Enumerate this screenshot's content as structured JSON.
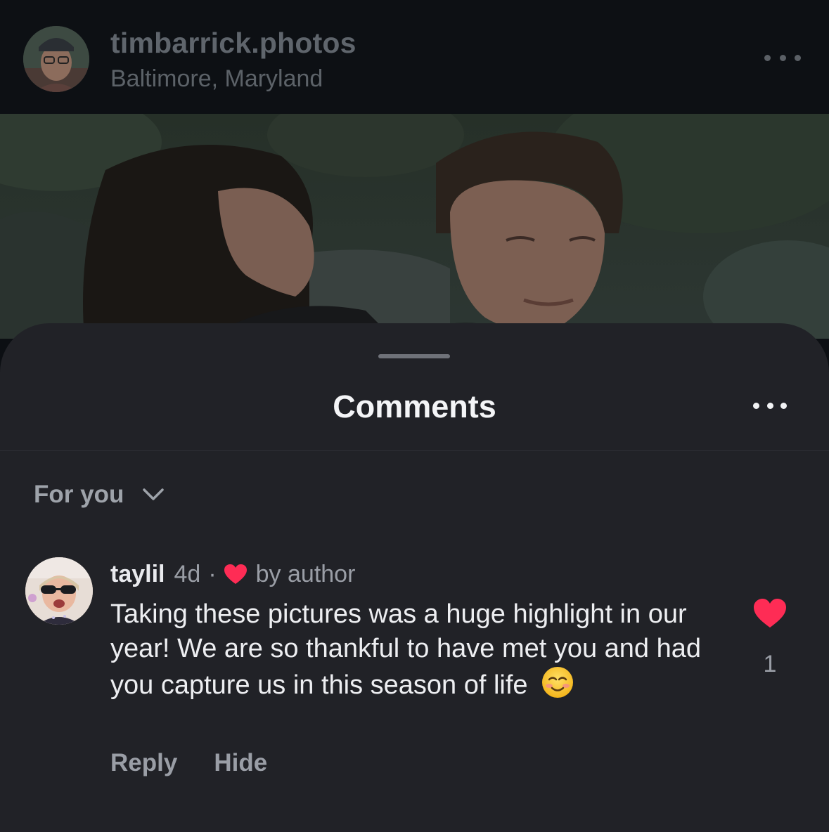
{
  "post": {
    "username": "timbarrick.photos",
    "location": "Baltimore, Maryland"
  },
  "sheet": {
    "title": "Comments",
    "sort_label": "For you"
  },
  "comment": {
    "username": "taylil",
    "time": "4d",
    "separator": "·",
    "liked_by_label": "by author",
    "text": "Taking these pictures was a huge highlight in our year! We are so thankful to have met you and had you capture us in this season of life",
    "emoji": "smiling-face-emoji",
    "like_count": "1",
    "reply_label": "Reply",
    "hide_label": "Hide"
  },
  "colors": {
    "like_red": "#fe2c55",
    "sheet_bg": "#212227",
    "header_bg": "#0d1014"
  },
  "icons": {
    "post_menu": "more-horizontal-icon",
    "sheet_menu": "more-horizontal-icon",
    "sort": "chevron-down-icon",
    "creator_liked": "heart-icon",
    "like": "heart-icon"
  }
}
